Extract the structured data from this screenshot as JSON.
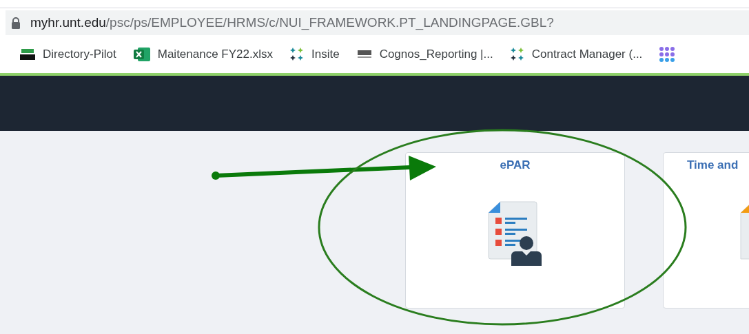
{
  "address_bar": {
    "domain": "myhr.unt.edu",
    "path": "/psc/ps/EMPLOYEE/HRMS/c/NUI_FRAMEWORK.PT_LANDINGPAGE.GBL?"
  },
  "bookmarks": [
    {
      "kind": "logo",
      "label": "Directory-Pilot"
    },
    {
      "kind": "spreadsheet",
      "label": "Maitenance FY22.xlsx"
    },
    {
      "kind": "sparkle",
      "label": "Insite"
    },
    {
      "kind": "seal",
      "label": "Cognos_Reporting |..."
    },
    {
      "kind": "sparkle",
      "label": "Contract Manager (..."
    },
    {
      "kind": "grid"
    }
  ],
  "tiles": [
    {
      "title": "ePAR",
      "kind": "form"
    },
    {
      "title": "Time and",
      "kind": "document"
    }
  ]
}
